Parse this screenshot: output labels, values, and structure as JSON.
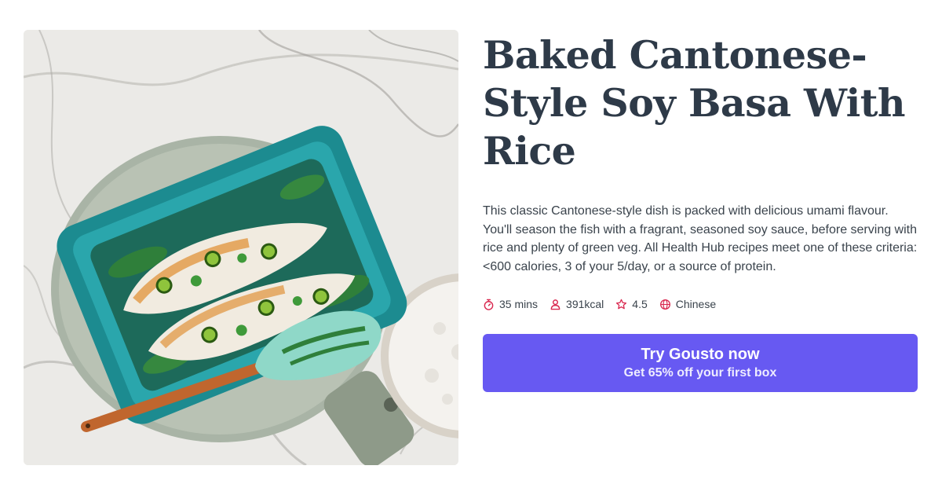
{
  "recipe": {
    "title": "Baked Cantonese-Style Soy Basa With Rice",
    "description": "This classic Cantonese-style dish is packed with delicious umami flavour. You'll season the fish with a fragrant, seasoned soy sauce, before serving with rice and plenty of green veg. All Health Hub recipes meet one of these criteria: <600 calories, 3 of your 5/day, or a source of protein.",
    "meta": {
      "time": {
        "icon": "stopwatch-icon",
        "label": "35 mins"
      },
      "calories": {
        "icon": "person-icon",
        "label": "391kcal"
      },
      "rating": {
        "icon": "star-icon",
        "label": "4.5"
      },
      "cuisine": {
        "icon": "globe-icon",
        "label": "Chinese"
      }
    }
  },
  "cta": {
    "title": "Try Gousto now",
    "subtitle": "Get 65% off your first box"
  },
  "colors": {
    "accent": "#6759f2",
    "icon": "#d9284f",
    "title": "#2e3a48",
    "body_text": "#3a434c"
  }
}
